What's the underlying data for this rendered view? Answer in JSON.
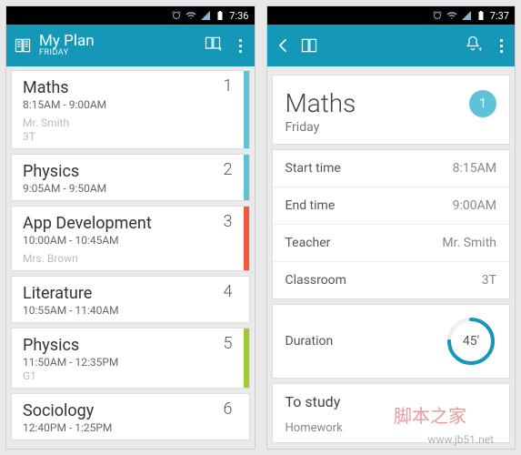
{
  "left": {
    "status_time": "7:36",
    "title": "My Plan",
    "subtitle": "FRIDAY",
    "items": [
      {
        "name": "Maths",
        "time": "8:15AM - 9:00AM",
        "teacher": "Mr. Smith",
        "room": "3T",
        "num": "1",
        "stripe": "#5ec3d9"
      },
      {
        "name": "Physics",
        "time": "9:05AM - 9:50AM",
        "teacher": "",
        "room": "",
        "num": "2",
        "stripe": "#5ec3d9"
      },
      {
        "name": "App Development",
        "time": "10:00AM - 10:45AM",
        "teacher": "Mrs. Brown",
        "room": "",
        "num": "3",
        "stripe": "#f15a3c"
      },
      {
        "name": "Literature",
        "time": "10:55AM - 11:40AM",
        "teacher": "",
        "room": "",
        "num": "4",
        "stripe": ""
      },
      {
        "name": "Physics",
        "time": "11:50AM - 12:35PM",
        "teacher": "",
        "room": "G1",
        "num": "5",
        "stripe": "#9acd32"
      },
      {
        "name": "Sociology",
        "time": "12:40PM - 1:25PM",
        "teacher": "",
        "room": "",
        "num": "6",
        "stripe": ""
      }
    ]
  },
  "right": {
    "status_time": "7:37",
    "name": "Maths",
    "day": "Friday",
    "badge": "1",
    "rows": [
      {
        "label": "Start time",
        "value": "8:15AM"
      },
      {
        "label": "End time",
        "value": "9:00AM"
      },
      {
        "label": "Teacher",
        "value": "Mr. Smith"
      },
      {
        "label": "Classroom",
        "value": "3T"
      }
    ],
    "duration_label": "Duration",
    "duration_value": "45'",
    "study_title": "To study",
    "study_items": [
      "Homework"
    ]
  },
  "watermark_cn": "脚本之家",
  "watermark_url": "www.jb51.net"
}
